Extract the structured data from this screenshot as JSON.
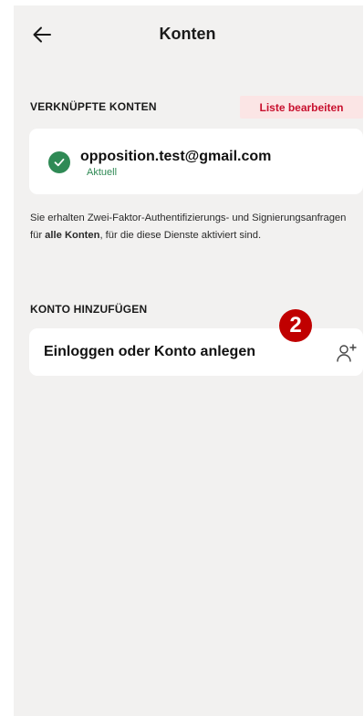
{
  "header": {
    "title": "Konten",
    "back_icon": "arrow-left-icon"
  },
  "linked_accounts": {
    "section_label": "VERKNÜPFTE KONTEN",
    "edit_label": "Liste bearbeiten",
    "account": {
      "email": "opposition.test@gmail.com",
      "status": "Aktuell",
      "status_icon": "check-circle-icon"
    },
    "info_text_1": "Sie erhalten Zwei-Faktor-Authentifizierungs- und Signierungsanfragen für ",
    "info_bold": "alle Konten",
    "info_text_2": ", für die diese Dienste aktiviert sind."
  },
  "add_account": {
    "section_label": "KONTO HINZUFÜGEN",
    "login_label": "Einloggen oder Konto anlegen",
    "icon": "add-user-icon"
  },
  "annotation_badge": "2",
  "colors": {
    "accent_red": "#c8102e",
    "edit_bg": "#fbe5e5",
    "success_green": "#2f8a55",
    "screen_bg": "#f2f1f0",
    "badge_red": "#c00000"
  }
}
